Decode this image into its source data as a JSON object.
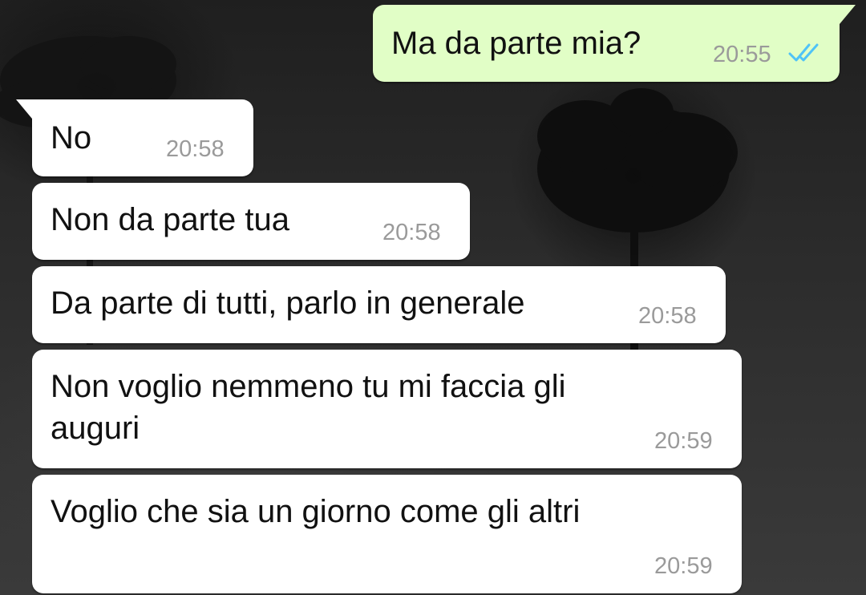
{
  "messages": [
    {
      "direction": "outgoing",
      "text": "Ma da parte mia?",
      "time": "20:55",
      "status_icon": "double-check-read-icon"
    },
    {
      "direction": "incoming",
      "text": "No",
      "time": "20:58"
    },
    {
      "direction": "incoming",
      "text": "Non da parte tua",
      "time": "20:58"
    },
    {
      "direction": "incoming",
      "text": "Da parte di tutti, parlo in generale",
      "time": "20:58"
    },
    {
      "direction": "incoming",
      "text_line1": "Non voglio nemmeno tu mi faccia gli",
      "text_line2": "auguri",
      "time": "20:59"
    },
    {
      "direction": "incoming",
      "text": "Voglio che sia un giorno come gli altri",
      "time": "20:59"
    }
  ],
  "colors": {
    "outgoing_bubble": "#e1fec6",
    "incoming_bubble": "#ffffff",
    "read_check": "#4fc3f7",
    "timestamp": "#9a9a9a",
    "wallpaper": "#2a2a2a"
  }
}
